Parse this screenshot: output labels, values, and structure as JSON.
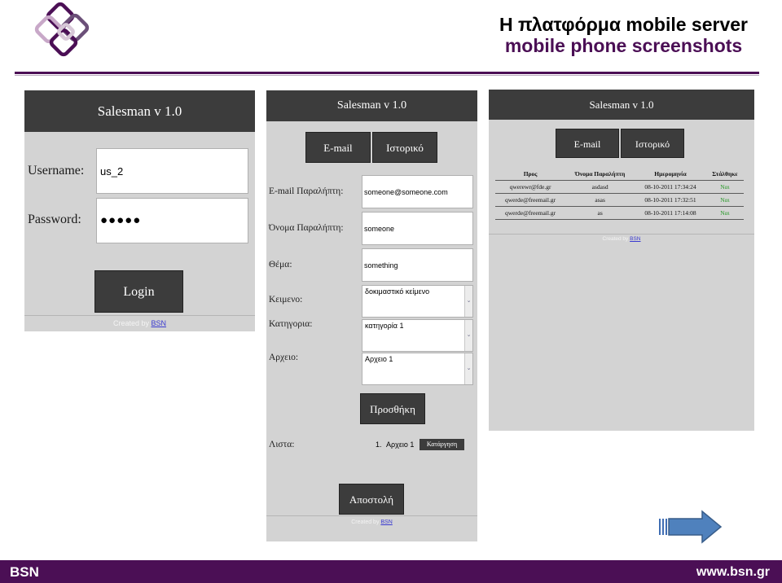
{
  "slide": {
    "title_line1": "Η πλατφόρμα mobile server",
    "title_line2": "mobile phone screenshots",
    "footer_left": "BSN",
    "footer_right": "www.bsn.gr",
    "colors": {
      "brand": "#4b0f55",
      "app_dark": "#3c3c3c",
      "screen_bg": "#d3d3d3"
    },
    "icons": {
      "logo": "bsn-logo-icon",
      "next": "next-arrow-icon"
    }
  },
  "login_screen": {
    "header": "Salesman v 1.0",
    "username_label": "Username:",
    "username_value": "us_2",
    "password_label": "Password:",
    "password_value": "●●●●●",
    "login_button": "Login",
    "footer_text": "Created by ",
    "footer_link": "BSN"
  },
  "email_screen": {
    "header": "Salesman v 1.0",
    "tab_email": "E-mail",
    "tab_history": "Ιστορικό",
    "recipient_email_label": "E-mail Παραλήπτη:",
    "recipient_email_value": "someone@someone.com",
    "recipient_name_label": "Όνομα Παραλήπτη:",
    "recipient_name_value": "someone",
    "subject_label": "Θέμα:",
    "subject_value": "something",
    "text_label": "Κειμενο:",
    "text_value": "δοκιμαστικό κείμενο",
    "category_label": "Κατηγορια:",
    "category_value": "κατηγορία 1",
    "file_label": "Αρχειο:",
    "file_value": "Αρχειο 1",
    "add_button": "Προσθήκη",
    "list_label": "Λιστα:",
    "list_item_number": "1.",
    "list_item": "Αρχειο 1",
    "remove_button": "Κατάργηση",
    "send_button": "Αποστολή",
    "footer_text": "Created by ",
    "footer_link": "BSN"
  },
  "history_screen": {
    "header": "Salesman v 1.0",
    "tab_email": "E-mail",
    "tab_history": "Ιστορικό",
    "columns": [
      "Προς",
      "Όνομα Παραλήπτη",
      "Ημερομηνία",
      "Στάλθηκε"
    ],
    "rows": [
      [
        "qwerewr@fde.gr",
        "asdasd",
        "08-10-2011 17:34:24",
        "Ναι"
      ],
      [
        "qwerde@freemail.gr",
        "asas",
        "08-10-2011 17:32:51",
        "Ναι"
      ],
      [
        "qwerde@freemail.gr",
        "as",
        "08-10-2011 17:14:08",
        "Ναι"
      ]
    ],
    "footer_text": "Created by ",
    "footer_link": "BSN"
  }
}
